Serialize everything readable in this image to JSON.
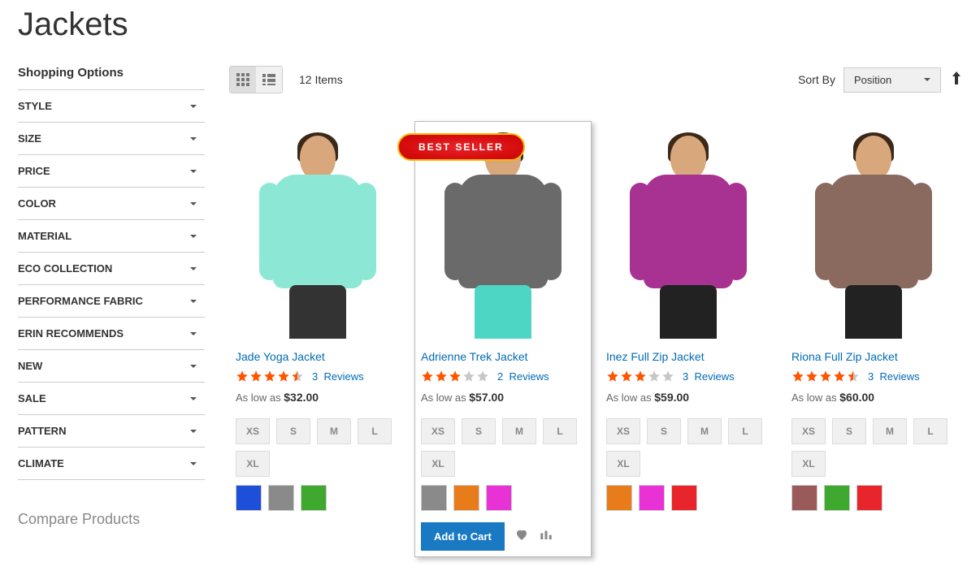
{
  "page_title": "Jackets",
  "sidebar": {
    "title": "Shopping Options",
    "filters": [
      "STYLE",
      "SIZE",
      "PRICE",
      "COLOR",
      "MATERIAL",
      "ECO COLLECTION",
      "PERFORMANCE FABRIC",
      "ERIN RECOMMENDS",
      "NEW",
      "SALE",
      "PATTERN",
      "CLIMATE"
    ],
    "compare": "Compare Products"
  },
  "toolbar": {
    "item_count": "12 Items",
    "sort_label": "Sort By",
    "sort_value": "Position"
  },
  "strings": {
    "as_low_as": "As low as",
    "reviews": "Reviews",
    "add_to_cart": "Add to Cart",
    "best_seller": "BEST SELLER"
  },
  "sizes": [
    "XS",
    "S",
    "M",
    "L",
    "XL"
  ],
  "products": [
    {
      "name": "Jade Yoga Jacket",
      "rating": 4.5,
      "review_count": 3,
      "price": "$32.00",
      "jacket_color": "#8ce8d4",
      "leg_color": "#333",
      "colors": [
        "#1e4fd8",
        "#8a8a8a",
        "#3fa82e"
      ],
      "badge": false,
      "hovered": false
    },
    {
      "name": "Adrienne Trek Jacket",
      "rating": 3,
      "review_count": 2,
      "price": "$57.00",
      "jacket_color": "#6a6a6a",
      "leg_color": "#4dd6c4",
      "colors": [
        "#8a8a8a",
        "#e87c1a",
        "#e832d6"
      ],
      "badge": true,
      "hovered": true
    },
    {
      "name": "Inez Full Zip Jacket",
      "rating": 3,
      "review_count": 3,
      "price": "$59.00",
      "jacket_color": "#a83292",
      "leg_color": "#222",
      "colors": [
        "#e87c1a",
        "#e832d6",
        "#e8252a"
      ],
      "badge": false,
      "hovered": false
    },
    {
      "name": "Riona Full Zip Jacket",
      "rating": 4.5,
      "review_count": 3,
      "price": "$60.00",
      "jacket_color": "#8a6a5e",
      "leg_color": "#222",
      "colors": [
        "#9a5a5a",
        "#3fa82e",
        "#e8252a"
      ],
      "badge": false,
      "hovered": false
    }
  ]
}
